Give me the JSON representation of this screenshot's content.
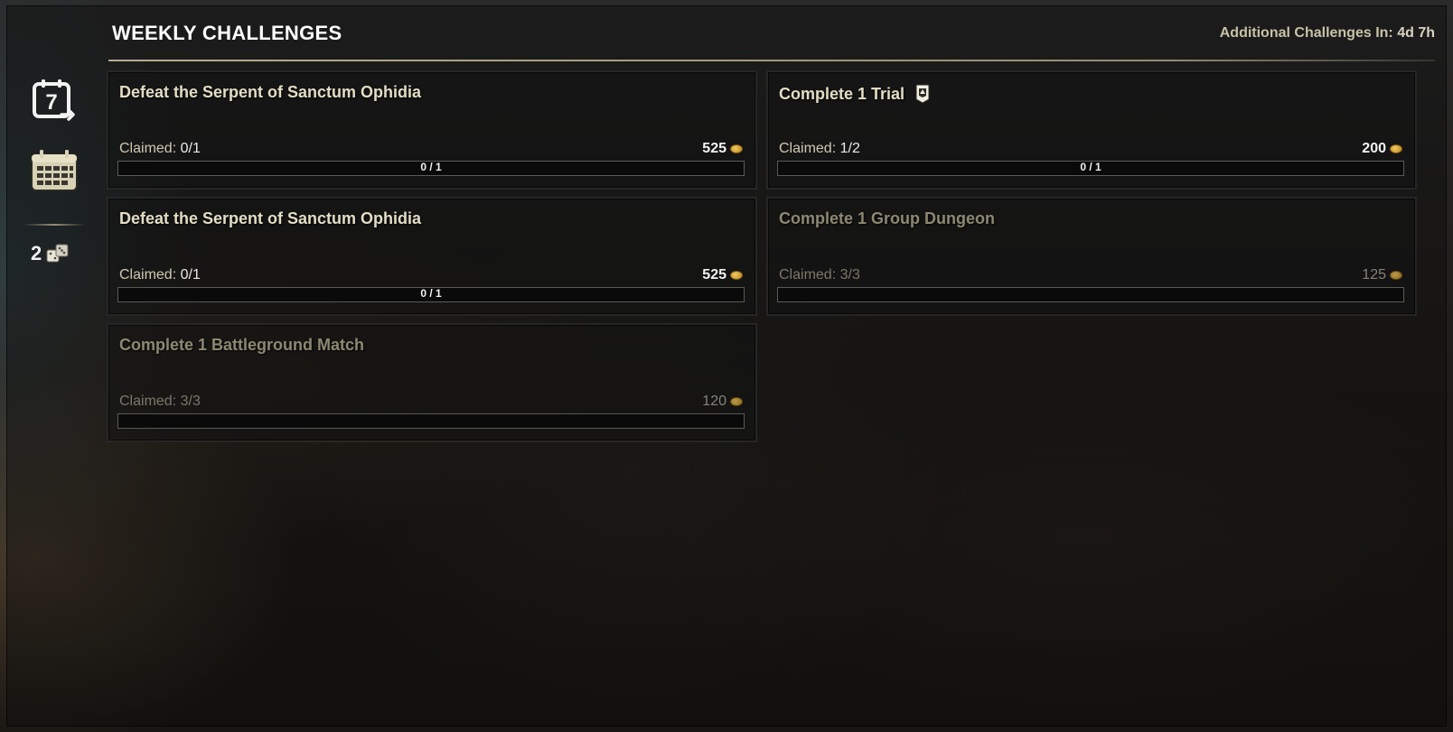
{
  "header": {
    "title": "WEEKLY CHALLENGES",
    "timer_label": "Additional Challenges In:",
    "timer_value": "4d 7h"
  },
  "rail": {
    "weekly_tab_icon": "calendar-7-icon",
    "weekly_tab_number": "7",
    "calendar_tab_icon": "calendar-grid-icon",
    "tokens_count": "2",
    "tokens_icon": "dice-tokens-icon"
  },
  "challenges": [
    {
      "title": "Defeat the Serpent of Sanctum Ophidia",
      "claimed_label": "Claimed:",
      "claimed_value": "0/1",
      "reward": "525",
      "reward_icon": "gold-coin-icon",
      "progress_label": "0 / 1",
      "progress": 0,
      "completed": false
    },
    {
      "title": "Complete 1 Trial",
      "title_icon": "trial-banner-icon",
      "claimed_label": "Claimed:",
      "claimed_value": "1/2",
      "reward": "200",
      "reward_icon": "gold-coin-icon",
      "progress_label": "0 / 1",
      "progress": 0,
      "completed": false
    },
    {
      "title": "Defeat the Serpent of Sanctum Ophidia",
      "claimed_label": "Claimed:",
      "claimed_value": "0/1",
      "reward": "525",
      "reward_icon": "gold-coin-icon",
      "progress_label": "0 / 1",
      "progress": 0,
      "completed": false
    },
    {
      "title": "Complete 1 Group Dungeon",
      "claimed_label": "Claimed:",
      "claimed_value": "3/3",
      "reward": "125",
      "reward_icon": "gold-coin-icon",
      "progress_label": "",
      "progress": 0,
      "completed": true
    },
    {
      "title": "Complete 1 Battleground Match",
      "claimed_label": "Claimed:",
      "claimed_value": "3/3",
      "reward": "120",
      "reward_icon": "gold-coin-icon",
      "progress_label": "",
      "progress": 0,
      "completed": true
    }
  ]
}
